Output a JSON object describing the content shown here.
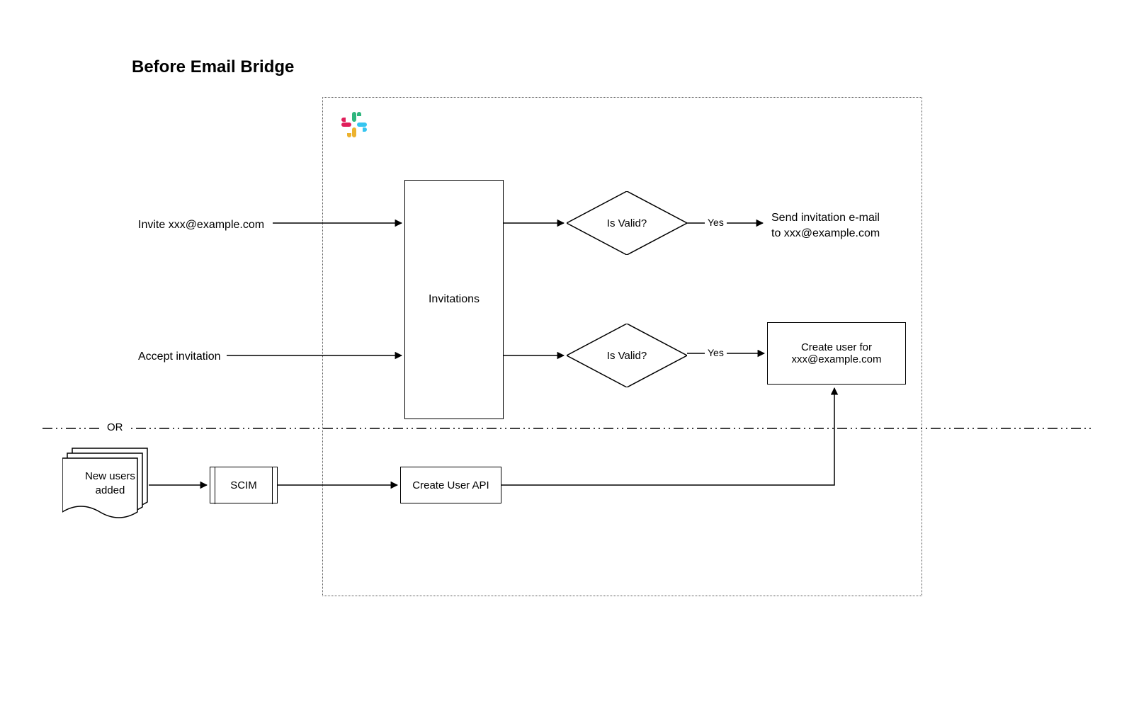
{
  "title": "Before Email Bridge",
  "icon_name": "slack-icon",
  "colors": {
    "slack_green": "#2EB67D",
    "slack_blue": "#36C5F0",
    "slack_red": "#E01E5A",
    "slack_yellow": "#ECB22E"
  },
  "inputs": {
    "invite": "Invite xxx@example.com",
    "accept": "Accept invitation"
  },
  "nodes": {
    "invitations": "Invitations",
    "is_valid_1": "Is Valid?",
    "is_valid_2": "Is Valid?",
    "send_email": "Send invitation e-mail\nto xxx@example.com",
    "create_user": "Create user for\nxxx@example.com",
    "new_users": "New users\nadded",
    "scim": "SCIM",
    "create_user_api": "Create User API"
  },
  "edge_labels": {
    "yes_1": "Yes",
    "yes_2": "Yes"
  },
  "divider_label": "OR"
}
